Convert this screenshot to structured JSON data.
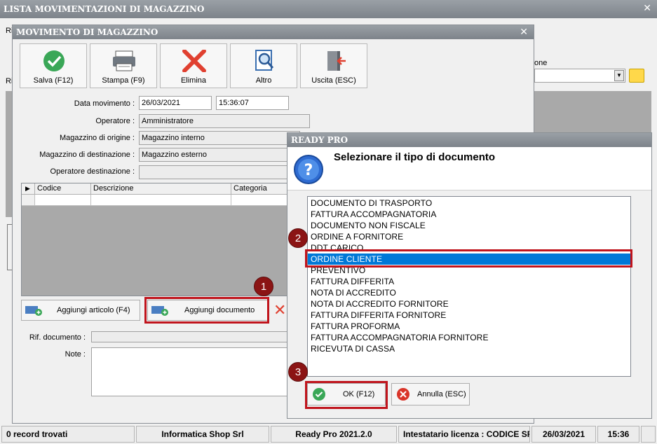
{
  "main_window": {
    "title": "LISTA MOVIMENTAZIONI DI MAGAZZINO",
    "partial_label_ri": "Ri",
    "partial_label_ri2": "Ri",
    "partial_label_one": "one"
  },
  "movimento": {
    "title": "MOVIMENTO DI MAGAZZINO",
    "toolbar": {
      "save": "Salva (F12)",
      "print": "Stampa (F9)",
      "delete": "Elimina",
      "other": "Altro",
      "exit": "Uscita (ESC)"
    },
    "fields": {
      "data_label": "Data movimento :",
      "data_value": "26/03/2021",
      "time_value": "15:36:07",
      "operatore_label": "Operatore :",
      "operatore_value": "Amministratore",
      "origine_label": "Magazzino di origine :",
      "origine_value": "Magazzino interno",
      "destinazione_label": "Magazzino di destinazione :",
      "destinazione_value": "Magazzino esterno",
      "op_dest_label": "Operatore destinazione :",
      "op_dest_value": ""
    },
    "grid": {
      "columns": [
        "Codice",
        "Descrizione",
        "Categoria"
      ]
    },
    "buttons": {
      "add_article": "Aggiungi articolo (F4)",
      "add_document": "Aggiungi documento"
    },
    "rif_label": "Rif. documento :",
    "note_label": "Note :"
  },
  "dialog": {
    "title": "READY PRO",
    "prompt": "Selezionare il tipo di documento",
    "items": [
      "DOCUMENTO DI TRASPORTO",
      "FATTURA ACCOMPAGNATORIA",
      "DOCUMENTO NON FISCALE",
      "ORDINE A FORNITORE",
      "DDT CARICO",
      "ORDINE CLIENTE",
      "PREVENTIVO",
      "FATTURA DIFFERITA",
      "NOTA DI ACCREDITO",
      "NOTA DI ACCREDITO FORNITORE",
      "FATTURA DIFFERITA FORNITORE",
      "FATTURA PROFORMA",
      "FATTURA ACCOMPAGNATORIA FORNITORE",
      "RICEVUTA DI CASSA"
    ],
    "selected_index": 5,
    "ok": "OK (F12)",
    "cancel": "Annulla (ESC)"
  },
  "badges": [
    "1",
    "2",
    "3"
  ],
  "statusbar": {
    "records": "0 record trovati",
    "company": "Informatica Shop Srl",
    "version": "Ready Pro 2021.2.0",
    "license": "Intestatario licenza : CODICE SRL",
    "date": "26/03/2021",
    "time": "15:36"
  },
  "colors": {
    "highlight": "#c0141c",
    "selection": "#0078d7",
    "badge": "#8b1414"
  }
}
